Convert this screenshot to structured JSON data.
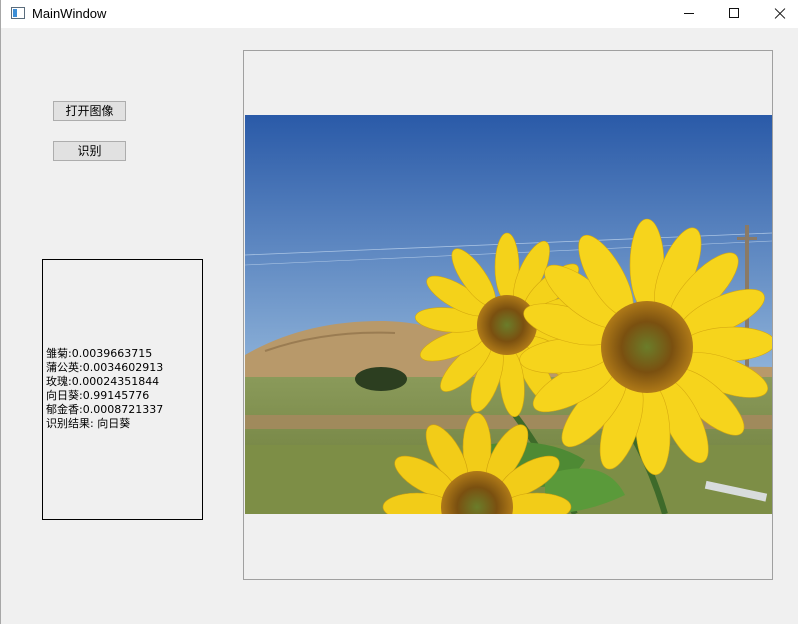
{
  "window": {
    "title": "MainWindow",
    "icons": {
      "app": "app-window-icon",
      "minimize": "minimize-icon",
      "maximize": "maximize-icon",
      "close": "close-icon"
    }
  },
  "toolbar": {
    "open_image_label": "打开图像",
    "recognize_label": "识别"
  },
  "results": {
    "lines": [
      "雏菊:0.0039663715",
      "蒲公英:0.0034602913",
      "玫瑰:0.00024351844",
      "向日葵:0.99145776",
      "郁金香:0.0008721337",
      "识别结果: 向日葵"
    ]
  },
  "image": {
    "subject": "sunflower-photo",
    "colors": {
      "sky": "#3565b0",
      "petal": "#f4d21a",
      "center": "#8a5a12",
      "hill": "#b89a68",
      "grass": "#6f8a3e"
    }
  }
}
